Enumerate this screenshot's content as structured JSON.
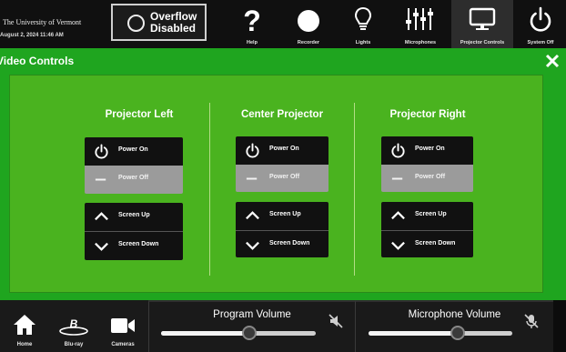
{
  "header": {
    "logo_text": "The University of Vermont",
    "datetime": "August 2, 2024 11:46 AM",
    "overflow_label_line1": "Overflow",
    "overflow_label_line2": "Disabled",
    "nav": [
      {
        "label": "Help",
        "icon": "help-icon"
      },
      {
        "label": "Recorder",
        "icon": "recorder-icon"
      },
      {
        "label": "Lights",
        "icon": "lightbulb-icon"
      },
      {
        "label": "Microphones",
        "icon": "mixer-sliders-icon"
      },
      {
        "label": "Projector Controls",
        "icon": "monitor-icon",
        "active": true
      },
      {
        "label": "System Off",
        "icon": "power-icon"
      }
    ]
  },
  "main": {
    "title": "Video Controls",
    "projectors": [
      {
        "title": "Projector Left",
        "power_on": "Power On",
        "power_off": "Power Off",
        "screen_up": "Screen Up",
        "screen_down": "Screen Down"
      },
      {
        "title": "Center Projector",
        "power_on": "Power On",
        "power_off": "Power Off",
        "screen_up": "Screen Up",
        "screen_down": "Screen Down"
      },
      {
        "title": "Projector Right",
        "power_on": "Power On",
        "power_off": "Power Off",
        "screen_up": "Screen Up",
        "screen_down": "Screen Down"
      }
    ]
  },
  "footer": {
    "nav": [
      {
        "label": "Home",
        "icon": "home-icon"
      },
      {
        "label": "Blu-ray",
        "icon": "bluray-icon"
      },
      {
        "label": "Cameras",
        "icon": "camera-icon"
      }
    ],
    "program_volume": {
      "title": "Program Volume",
      "level": 0.57,
      "muted": true
    },
    "microphone_volume": {
      "title": "Microphone Volume",
      "level": 0.62,
      "muted": true
    }
  },
  "colors": {
    "background_green": "#1fa51f",
    "panel_green": "#4ab31f",
    "button_dark": "#111111",
    "button_off_gray": "#9b9b9b"
  }
}
